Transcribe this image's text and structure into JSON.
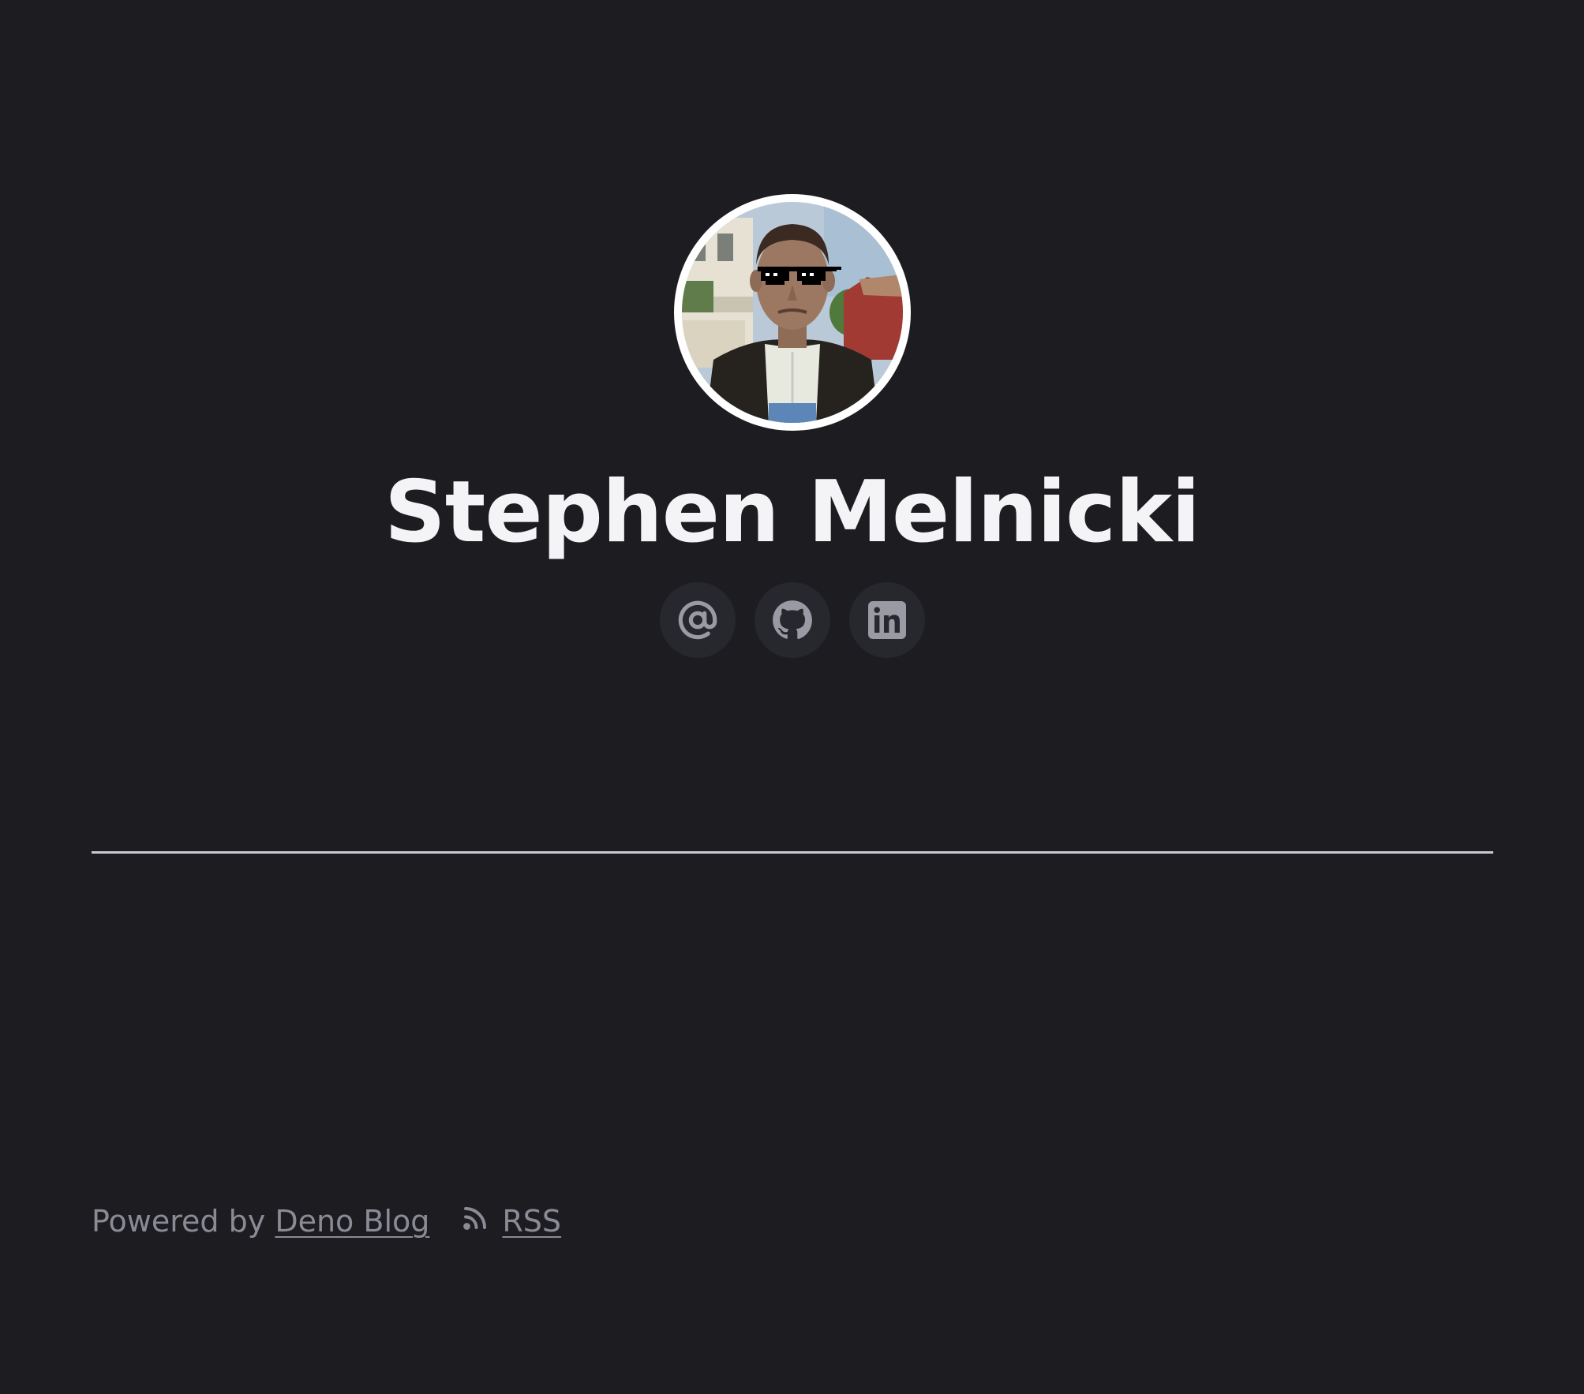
{
  "profile": {
    "name": "Stephen Melnicki",
    "avatar_icon": "profile-photo"
  },
  "socials": [
    {
      "icon": "at-sign-icon",
      "kind": "email"
    },
    {
      "icon": "github-icon",
      "kind": "github"
    },
    {
      "icon": "linkedin-icon",
      "kind": "linkedin"
    }
  ],
  "footer": {
    "powered_prefix": "Powered by ",
    "powered_link": "Deno Blog",
    "rss_label": "RSS",
    "rss_icon": "rss-icon"
  },
  "colors": {
    "background": "#1c1c21",
    "text_primary": "#f4f4f6",
    "text_muted": "#8b8b95",
    "social_bg": "#27272e",
    "divider": "#c9c9cf"
  }
}
